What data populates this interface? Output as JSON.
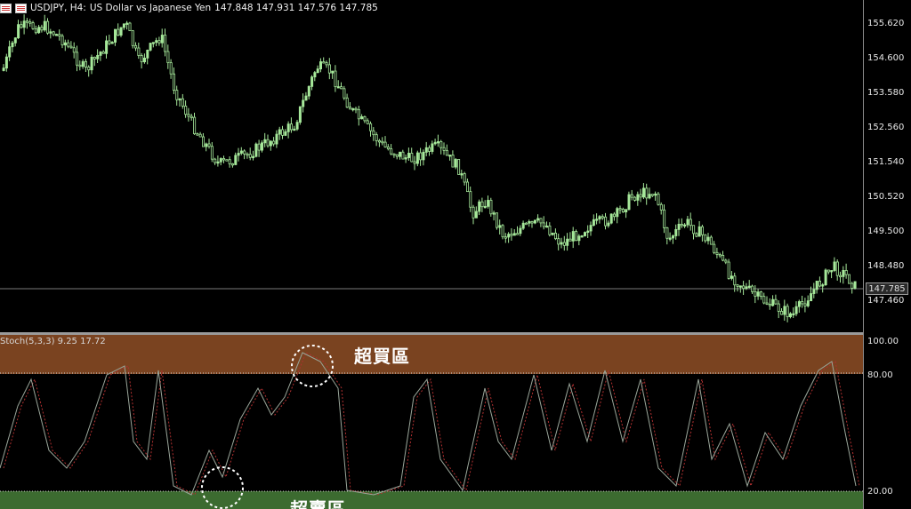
{
  "header": {
    "symbol_icon": "flag-icon",
    "symbol": "USDJPY, H4:",
    "description": "US Dollar vs Japanese Yen",
    "ohlc": "147.848 147.931 147.576 147.785"
  },
  "price_axis": {
    "ticks": [
      "155.620",
      "154.600",
      "153.580",
      "152.560",
      "151.540",
      "150.520",
      "149.500",
      "148.480",
      "147.460"
    ],
    "current_price": "147.785"
  },
  "indicator": {
    "label": "Stoch(5,3,3) 9.25 17.72",
    "overbought_label": "超買區",
    "oversold_label": "超賣區",
    "ticks": [
      "100.00",
      "80.00",
      "20.00"
    ]
  },
  "colors": {
    "background": "#000000",
    "bull_candle": "#a6e89a",
    "bear_candle": "#a6e89a",
    "overbought_band": "#7a4320",
    "oversold_band": "#3c6b30",
    "stoch_main": "#9aa69a",
    "stoch_signal": "#b03030",
    "highlight_circle": "#ffffff"
  }
}
